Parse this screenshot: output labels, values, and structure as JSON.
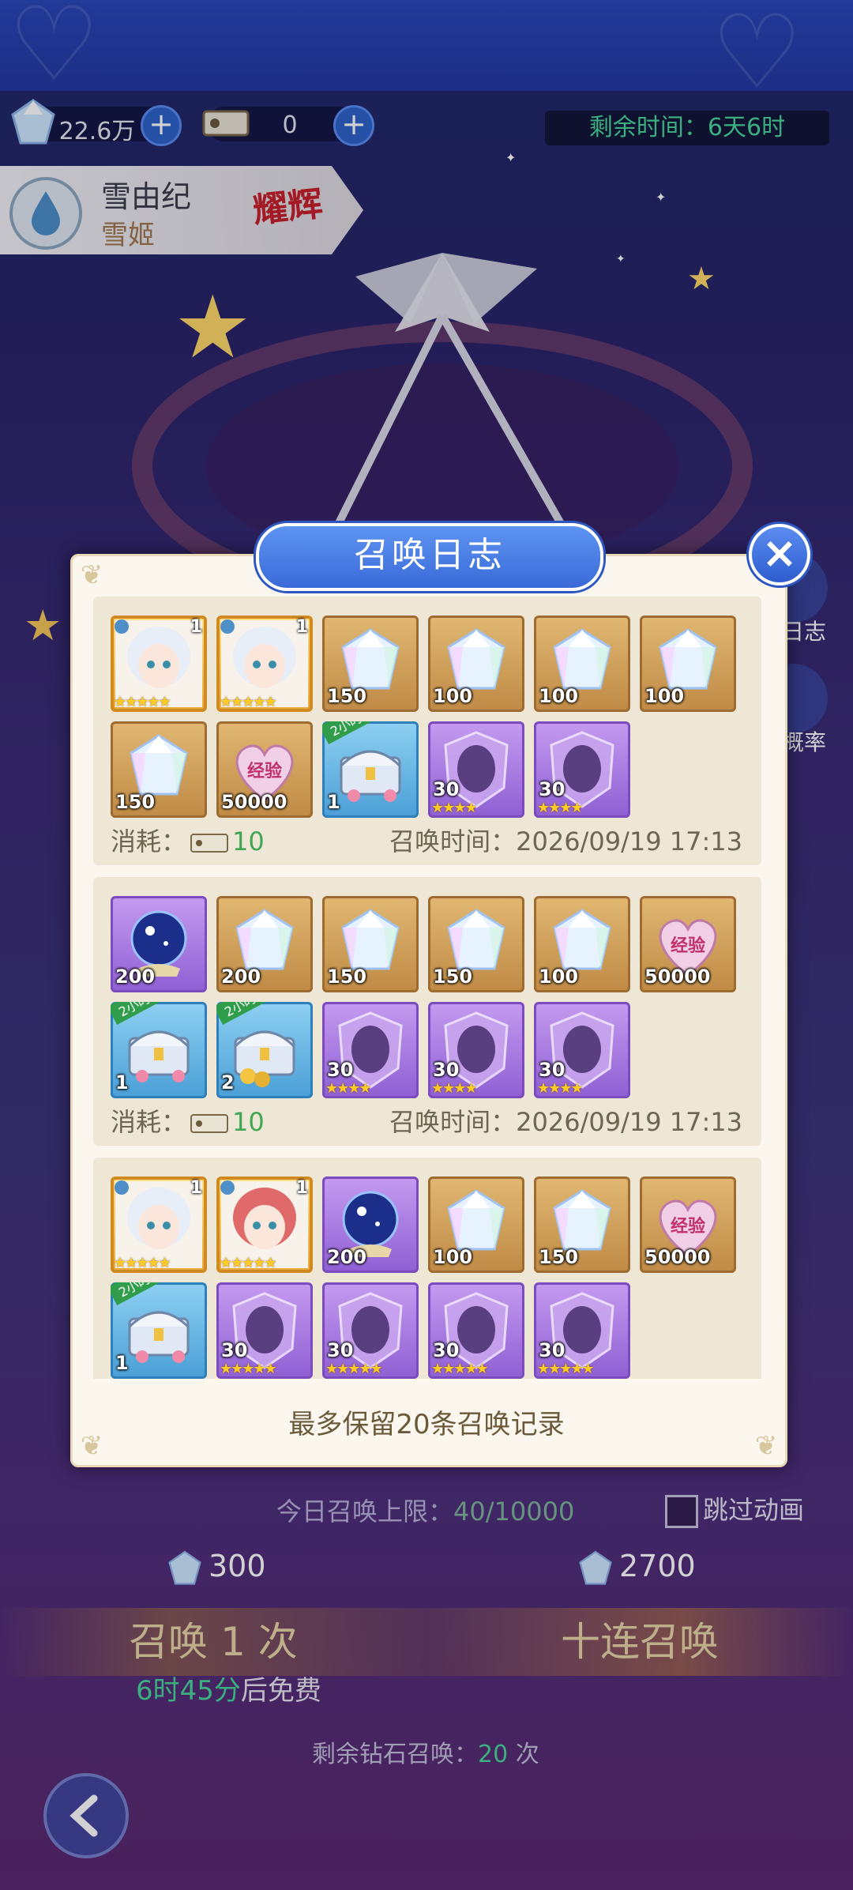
{
  "header": {
    "currency_diamond": "22.6万",
    "currency_ticket": "0",
    "plus_label": "+",
    "timer_label": "剩余时间：",
    "timer_value": "6天6时"
  },
  "character": {
    "name": "雪由纪",
    "subtitle": "雪姬",
    "badge": "耀辉"
  },
  "side_tabs": [
    {
      "label": "日志",
      "icon": "log-icon"
    },
    {
      "label": "概率",
      "icon": "dice-icon"
    }
  ],
  "dialog": {
    "title": "召唤日志",
    "close_icon": "close-icon",
    "cost_label": "消耗：",
    "time_label": "召唤时间：",
    "footer_note": "最多保留20条召唤记录",
    "records": [
      {
        "cost": "10",
        "time": "2026/09/19 17:13",
        "items": [
          {
            "type": "character",
            "qty": "",
            "level": "1",
            "stars": "★★★★★"
          },
          {
            "type": "character",
            "qty": "",
            "level": "1",
            "stars": "★★★★★"
          },
          {
            "type": "diamond",
            "qty": "150"
          },
          {
            "type": "diamond",
            "qty": "100"
          },
          {
            "type": "diamond",
            "qty": "100"
          },
          {
            "type": "diamond",
            "qty": "100"
          },
          {
            "type": "diamond",
            "qty": "150"
          },
          {
            "type": "exp",
            "qty": "50000",
            "label": "经验"
          },
          {
            "type": "chest",
            "qty": "1",
            "tag": "2小时"
          },
          {
            "type": "shard",
            "qty": "30",
            "stars": "★★★★"
          },
          {
            "type": "shard",
            "qty": "30",
            "stars": "★★★★"
          }
        ]
      },
      {
        "cost": "10",
        "time": "2026/09/19 17:13",
        "items": [
          {
            "type": "orb",
            "qty": "200"
          },
          {
            "type": "diamond",
            "qty": "200"
          },
          {
            "type": "diamond",
            "qty": "150"
          },
          {
            "type": "diamond",
            "qty": "150"
          },
          {
            "type": "diamond",
            "qty": "100"
          },
          {
            "type": "exp",
            "qty": "50000",
            "label": "经验"
          },
          {
            "type": "chest",
            "qty": "1",
            "tag": "2小时"
          },
          {
            "type": "chest-gold",
            "qty": "2",
            "tag": "2小时"
          },
          {
            "type": "shard",
            "qty": "30",
            "stars": "★★★★"
          },
          {
            "type": "shard",
            "qty": "30",
            "stars": "★★★★"
          },
          {
            "type": "shard",
            "qty": "30",
            "stars": "★★★★"
          }
        ]
      },
      {
        "cost": "",
        "time": "",
        "items": [
          {
            "type": "character",
            "qty": "",
            "level": "1",
            "stars": "★★★★★"
          },
          {
            "type": "character2",
            "qty": "",
            "level": "1",
            "stars": "★★★★★"
          },
          {
            "type": "orb",
            "qty": "200"
          },
          {
            "type": "diamond",
            "qty": "100"
          },
          {
            "type": "diamond",
            "qty": "150"
          },
          {
            "type": "exp",
            "qty": "50000",
            "label": "经验"
          },
          {
            "type": "chest",
            "qty": "1",
            "tag": "2小时"
          },
          {
            "type": "shard",
            "qty": "30",
            "stars": "★★★★★"
          },
          {
            "type": "shard",
            "qty": "30",
            "stars": "★★★★★"
          },
          {
            "type": "shard",
            "qty": "30",
            "stars": "★★★★★"
          },
          {
            "type": "shard",
            "qty": "30",
            "stars": "★★★★★"
          }
        ]
      }
    ]
  },
  "summon": {
    "daily_limit_label": "今日召唤上限：",
    "daily_limit_value": "40/10000",
    "skip_label": "跳过动画",
    "single_cost": "300",
    "ten_cost": "2700",
    "single_label": "召唤 1 次",
    "ten_label": "十连召唤",
    "free_time": "6时45分",
    "free_suffix": "后免费",
    "remain_label": "剩余钻石召唤：",
    "remain_value": "20",
    "remain_unit": "次"
  },
  "colors": {
    "accent_blue": "#3a6ad8",
    "green_text": "#49d69a",
    "dialog_bg": "#fbf7ee",
    "gold_tile": "#d3a35c",
    "purple_tile": "#a97ae2"
  }
}
